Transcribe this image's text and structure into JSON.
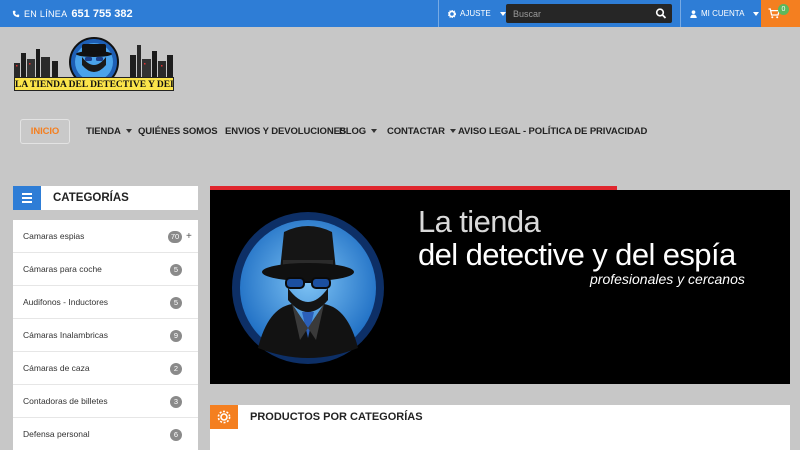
{
  "topbar": {
    "phone_label": "EN LÍNEA",
    "phone_number": "651 755 382",
    "settings_label": "AJUSTE",
    "search_placeholder": "Buscar",
    "account_label": "MI CUENTA",
    "cart_count": "0",
    "colors": {
      "bar": "#2e7dd6",
      "cart": "#f47f20",
      "badge": "#5cb85c"
    }
  },
  "logo": {
    "text": "LA TIENDA DEL DETECTIVE Y DEL ESPÍA"
  },
  "nav": [
    {
      "label": "INICIO",
      "active": true
    },
    {
      "label": "TIENDA",
      "dropdown": true
    },
    {
      "label": "QUIÉNES SOMOS"
    },
    {
      "label": "ENVIOS Y DEVOLUCIONES"
    },
    {
      "label": "BLOG",
      "dropdown": true
    },
    {
      "label": "CONTACTAR",
      "dropdown": true
    },
    {
      "label": "AVISO LEGAL - POLÍTICA DE PRIVACIDAD"
    }
  ],
  "sidebar": {
    "title": "CATEGORÍAS",
    "items": [
      {
        "label": "Camaras espias",
        "count": "70",
        "expand": "+"
      },
      {
        "label": "Cámaras para coche",
        "count": "5"
      },
      {
        "label": "Audifonos - Inductores",
        "count": "5"
      },
      {
        "label": "Cámaras Inalambricas",
        "count": "9"
      },
      {
        "label": "Cámaras de caza",
        "count": "2"
      },
      {
        "label": "Contadoras de billetes",
        "count": "3"
      },
      {
        "label": "Defensa personal",
        "count": "6"
      }
    ]
  },
  "banner": {
    "line1": "La tienda",
    "line2": "del detective y del espía",
    "line3": "profesionales y cercanos"
  },
  "products": {
    "title": "PRODUCTOS POR CATEGORÍAS"
  }
}
